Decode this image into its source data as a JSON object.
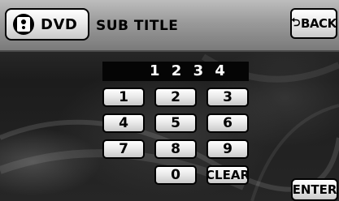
{
  "header": {
    "source_label": "DVD",
    "source_icon": "speaker-disc-icon",
    "title": "SUB TITLE",
    "back_label": "BACK",
    "back_icon": "return-arrow-icon"
  },
  "display": {
    "value": "1 2 3 4"
  },
  "keypad": {
    "keys": [
      "1",
      "2",
      "3",
      "4",
      "5",
      "6",
      "7",
      "8",
      "9",
      "0",
      "CLEAR"
    ]
  },
  "footer": {
    "enter_label": "ENTER"
  },
  "colors": {
    "button_face": "#f2f2f2",
    "header_bar": "#9a9a9a",
    "display_bg": "#050505"
  }
}
